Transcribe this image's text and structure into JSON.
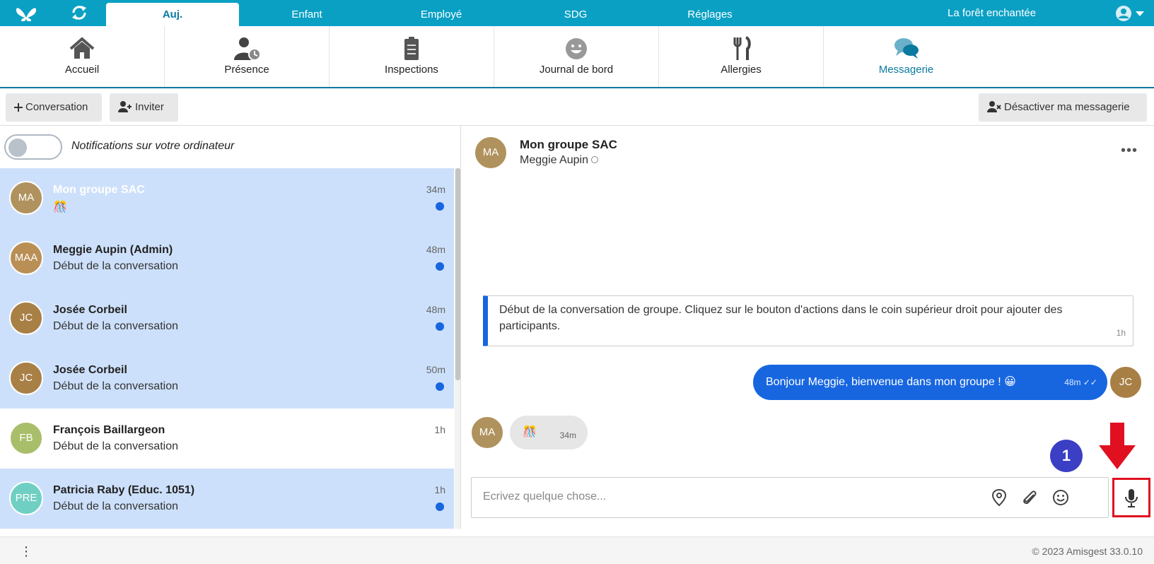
{
  "colors": {
    "topbar": "#0aa0c4",
    "accent": "#0a7aa0",
    "unread_dot": "#1766e0",
    "selected_row": "#cde0fb",
    "annotation_red": "#e01020",
    "annotation_badge": "#3a3fc4"
  },
  "topnav": {
    "icons": [
      "butterfly-logo-icon",
      "sync-icon",
      "user-icon",
      "chevron-down-icon"
    ],
    "tabs": [
      "Auj.",
      "Enfant",
      "Employé",
      "SDG",
      "Réglages"
    ],
    "active_tab": "Auj.",
    "site_name": "La forêt enchantée"
  },
  "modules": [
    {
      "label": "Accueil",
      "icon": "home-icon"
    },
    {
      "label": "Présence",
      "icon": "user-clock-icon"
    },
    {
      "label": "Inspections",
      "icon": "clipboard-icon"
    },
    {
      "label": "Journal de bord",
      "icon": "smiley-icon"
    },
    {
      "label": "Allergies",
      "icon": "fork-knife-icon"
    },
    {
      "label": "Messagerie",
      "icon": "chat-bubbles-icon",
      "active": true
    }
  ],
  "toolbar": {
    "conversation_label": "Conversation",
    "invite_label": "Inviter",
    "disable_label": "Désactiver ma messagerie"
  },
  "notifications": {
    "label": "Notifications sur votre ordinateur",
    "enabled": false
  },
  "conversations": [
    {
      "initials": "MA",
      "name": "Mon groupe SAC",
      "preview": "🎊",
      "time": "34m",
      "unread": true,
      "highlight": true,
      "color": "#b0925e"
    },
    {
      "initials": "MAA",
      "name": "Meggie Aupin (Admin)",
      "preview": "Début de la conversation",
      "time": "48m",
      "unread": true,
      "highlight": true,
      "color": "#b98f55"
    },
    {
      "initials": "JC",
      "name": "Josée Corbeil",
      "preview": "Début de la conversation",
      "time": "48m",
      "unread": true,
      "highlight": true,
      "color": "#a87f45"
    },
    {
      "initials": "JC",
      "name": "Josée Corbeil",
      "preview": "Début de la conversation",
      "time": "50m",
      "unread": true,
      "highlight": true,
      "color": "#a87f45"
    },
    {
      "initials": "FB",
      "name": "François Baillargeon",
      "preview": "Début de la conversation",
      "time": "1h",
      "unread": false,
      "highlight": false,
      "color": "#a9be6a"
    },
    {
      "initials": "PRE",
      "name": "Patricia Raby (Educ. 1051)",
      "preview": "Début de la conversation",
      "time": "1h",
      "unread": true,
      "highlight": true,
      "color": "#6fcfc2"
    }
  ],
  "chat": {
    "header": {
      "initials": "MA",
      "title": "Mon groupe SAC",
      "subtitle": "Meggie Aupin"
    },
    "system_message": {
      "text": "Début de la conversation de groupe. Cliquez sur le bouton d'actions dans le coin supérieur droit pour ajouter des participants.",
      "time": "1h"
    },
    "outgoing": {
      "text": "Bonjour Meggie, bienvenue dans mon groupe ! 😀",
      "time": "48m ✓✓",
      "initials": "JC"
    },
    "incoming": {
      "text": "🎊",
      "time": "34m",
      "initials": "MA"
    },
    "composer": {
      "placeholder": "Ecrivez quelque chose...",
      "icons": [
        "location-pin-icon",
        "paperclip-icon",
        "emoji-icon",
        "microphone-icon"
      ]
    },
    "annotation": {
      "step": "1"
    }
  },
  "footer": {
    "copyright": "© 2023 Amisgest 33.0.10"
  }
}
